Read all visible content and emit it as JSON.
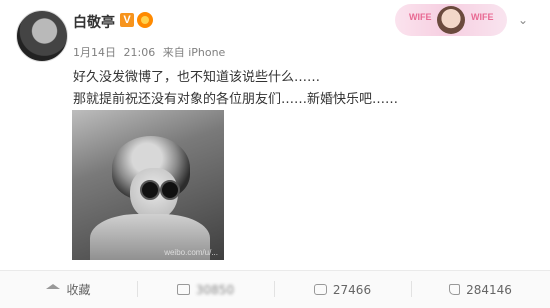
{
  "post": {
    "username": "白敬亭",
    "vip_badge": "V",
    "meta": {
      "date": "1月14日",
      "time": "21:06",
      "source": "来自 iPhone"
    },
    "text_lines": [
      "好久没发微博了，也不知道该说些什么……",
      "那就提前祝还没有对象的各位朋友们……新婚快乐吧……"
    ],
    "image_watermark": "weibo.com/u/..."
  },
  "header_card": {
    "left_word": "WIFE",
    "right_word": "WIFE"
  },
  "actions": {
    "favorite": "收藏",
    "repost": "30850",
    "comment": "27466",
    "like": "284146"
  },
  "icons": {
    "favorite": "star-icon",
    "repost": "share-icon",
    "comment": "comment-icon",
    "like": "thumbs-up-icon",
    "menu": "chevron-down-icon"
  }
}
